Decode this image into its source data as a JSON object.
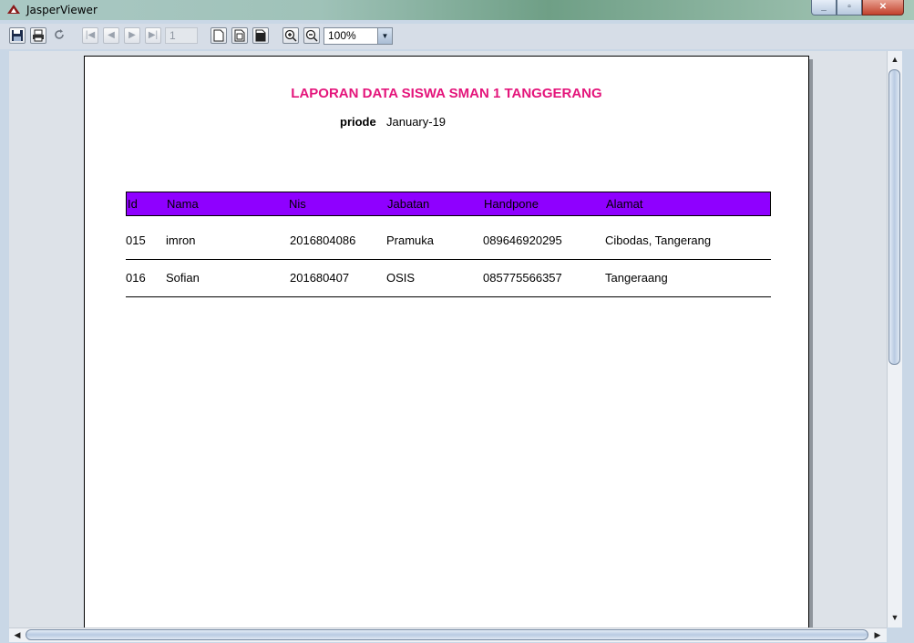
{
  "window": {
    "title": "JasperViewer",
    "minimize_glyph": "_",
    "maximize_glyph": "▫",
    "close_glyph": "✕"
  },
  "toolbar": {
    "save_icon": "floppy-disk",
    "print_icon": "printer",
    "reload_icon": "refresh",
    "first_page_icon": "first-page",
    "prev_page_icon": "prev-page",
    "next_page_icon": "next-page",
    "last_page_icon": "last-page",
    "page_number": "1",
    "zoom_value": "100%"
  },
  "report": {
    "title": "LAPORAN DATA SISWA SMAN 1 TANGGERANG",
    "period_label": "priode",
    "period_value": "January-19",
    "columns": [
      "Id",
      "Nama",
      "Nis",
      "Jabatan",
      "Handpone",
      "Alamat"
    ],
    "rows": [
      {
        "id": "015",
        "nama": "imron",
        "nis": "2016804086",
        "jabatan": "Pramuka",
        "handpone": "089646920295",
        "alamat": "Cibodas, Tangerang"
      },
      {
        "id": "016",
        "nama": "Sofian",
        "nis": "201680407",
        "jabatan": "OSIS",
        "handpone": "085775566357",
        "alamat": "Tangeraang"
      }
    ]
  },
  "colors": {
    "title": "#e4157b",
    "header_bg": "#8f00ff"
  }
}
